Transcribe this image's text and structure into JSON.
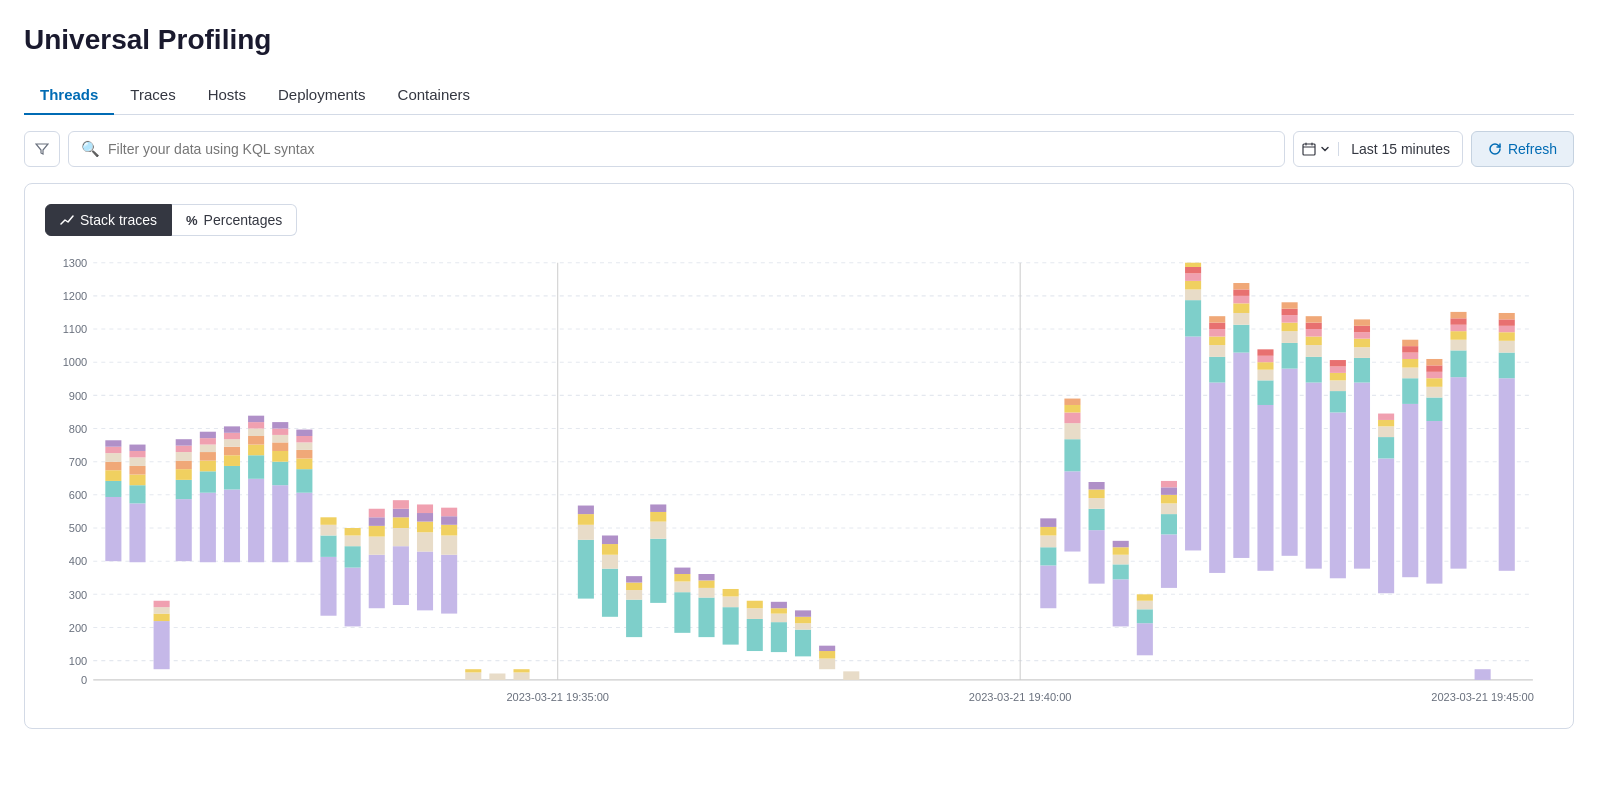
{
  "page": {
    "title": "Universal Profiling"
  },
  "tabs": [
    {
      "id": "threads",
      "label": "Threads",
      "active": true
    },
    {
      "id": "traces",
      "label": "Traces",
      "active": false
    },
    {
      "id": "hosts",
      "label": "Hosts",
      "active": false
    },
    {
      "id": "deployments",
      "label": "Deployments",
      "active": false
    },
    {
      "id": "containers",
      "label": "Containers",
      "active": false
    }
  ],
  "toolbar": {
    "search_placeholder": "Filter your data using KQL syntax",
    "time_label": "Last 15 minutes",
    "refresh_label": "Refresh"
  },
  "chart": {
    "toggle_stack_traces": "Stack traces",
    "toggle_percentages": "Percentages",
    "y_labels": [
      "1300",
      "1200",
      "1100",
      "1000",
      "900",
      "800",
      "700",
      "600",
      "500",
      "400",
      "300",
      "200",
      "100",
      "0"
    ],
    "x_labels": [
      "2023-03-21 19:35:00",
      "2023-03-21 19:40:00",
      "2023-03-21 19:45:00"
    ],
    "colors": {
      "teal": "#7ecfca",
      "lavender": "#c5b8e8",
      "beige": "#e8dcc8",
      "yellow": "#f0d060",
      "pink": "#f0a0b0",
      "orange": "#f0a878",
      "red": "#e87070",
      "blue": "#a0b8e8",
      "green": "#90c878",
      "purple": "#b090c8",
      "salmon": "#f0b8a0",
      "mauve": "#c8a0c0"
    }
  }
}
